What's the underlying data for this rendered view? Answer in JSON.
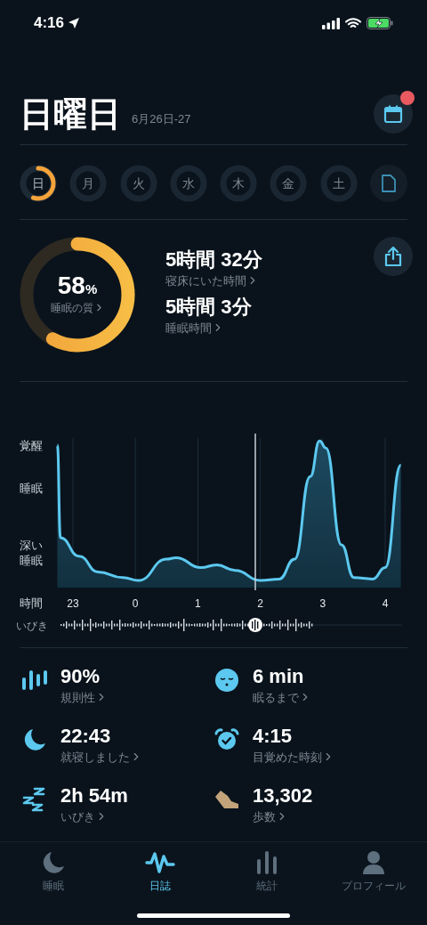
{
  "status_bar": {
    "time": "4:16"
  },
  "header": {
    "title": "日曜日",
    "date_range": "6月26日-27",
    "calendar_badge": true
  },
  "week_days": [
    {
      "label": "日",
      "selected": true
    },
    {
      "label": "月",
      "selected": false
    },
    {
      "label": "火",
      "selected": false
    },
    {
      "label": "水",
      "selected": false
    },
    {
      "label": "木",
      "selected": false
    },
    {
      "label": "金",
      "selected": false
    },
    {
      "label": "土",
      "selected": false
    }
  ],
  "summary": {
    "quality": {
      "value": "58",
      "unit": "%",
      "label": "睡眠の質",
      "level": 0.58
    },
    "stats": [
      {
        "value": "5時間 32分",
        "label": "寝床にいた時間"
      },
      {
        "value": "5時間 3分",
        "label": "睡眠時間"
      }
    ]
  },
  "sleep_chart": {
    "x_axis_label": "時間",
    "snore_label": "いびき",
    "stage_labels": [
      "覚醒",
      "睡眠",
      "深い睡眠"
    ],
    "hour_labels": [
      "23",
      "0",
      "1",
      "2",
      "3",
      "4"
    ]
  },
  "metrics": [
    {
      "kind": "regularity",
      "value": "90%",
      "label": "規則性"
    },
    {
      "kind": "latency",
      "value": "6 min",
      "label": "眠るまで"
    },
    {
      "kind": "bedtime",
      "value": "22:43",
      "label": "就寝しました"
    },
    {
      "kind": "wake",
      "value": "4:15",
      "label": "目覚めた時刻"
    },
    {
      "kind": "snore",
      "value": "2h 54m",
      "label": "いびき"
    },
    {
      "kind": "steps",
      "value": "13,302",
      "label": "歩数"
    }
  ],
  "tab_bar": [
    {
      "kind": "sleep",
      "label": "睡眠",
      "selected": false
    },
    {
      "kind": "journal",
      "label": "日誌",
      "selected": true
    },
    {
      "kind": "stats",
      "label": "統計",
      "selected": false
    },
    {
      "kind": "profile",
      "label": "プロフィール",
      "selected": false
    }
  ]
}
